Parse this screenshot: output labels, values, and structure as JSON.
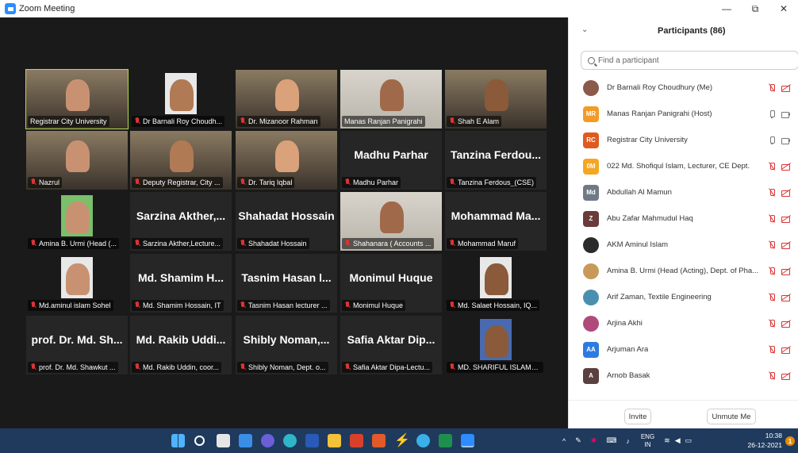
{
  "window": {
    "title": "Zoom Meeting",
    "minimize": "—",
    "restore": "⧉",
    "close": "✕"
  },
  "tiles": [
    {
      "big": "",
      "label": "Registrar City University",
      "muted": false,
      "video": true
    },
    {
      "big": "",
      "label": "Dr Barnali Roy Choudh...",
      "muted": true,
      "video": true
    },
    {
      "big": "",
      "label": "Dr. Mizanoor Rahman",
      "muted": true,
      "video": true
    },
    {
      "big": "",
      "label": "Manas Ranjan Panigrahi",
      "muted": false,
      "video": true
    },
    {
      "big": "",
      "label": "Shah E Alam",
      "muted": true,
      "video": true
    },
    {
      "big": "",
      "label": "Nazrul",
      "muted": true,
      "video": true
    },
    {
      "big": "",
      "label": "Deputy Registrar, City ...",
      "muted": true,
      "video": true
    },
    {
      "big": "",
      "label": "Dr. Tariq Iqbal",
      "muted": true,
      "video": true
    },
    {
      "big": "Madhu Parhar",
      "label": "Madhu Parhar",
      "muted": true,
      "video": false
    },
    {
      "big": "Tanzina Ferdou...",
      "label": "Tanzina Ferdous_(CSE)",
      "muted": true,
      "video": false
    },
    {
      "big": "",
      "label": "Amina B. Urmi (Head (...",
      "muted": true,
      "video": true
    },
    {
      "big": "Sarzina Akther,...",
      "label": "Sarzina Akther,Lecture...",
      "muted": true,
      "video": false
    },
    {
      "big": "Shahadat Hossain",
      "label": "Shahadat Hossain",
      "muted": true,
      "video": false
    },
    {
      "big": "",
      "label": "Shahanara ( Accounts ...",
      "muted": true,
      "video": true
    },
    {
      "big": "Mohammad Ma...",
      "label": "Mohammad Maruf",
      "muted": true,
      "video": false
    },
    {
      "big": "",
      "label": "Md.aminul islam Sohel",
      "muted": true,
      "video": true
    },
    {
      "big": "Md. Shamim H...",
      "label": "Md. Shamim Hossain, IT",
      "muted": true,
      "video": false
    },
    {
      "big": "Tasnim Hasan l...",
      "label": "Tasnim Hasan lecturer ...",
      "muted": true,
      "video": false
    },
    {
      "big": "Monimul Huque",
      "label": "Monimul Huque",
      "muted": true,
      "video": false
    },
    {
      "big": "",
      "label": "Md. Salaet Hossain, IQ...",
      "muted": true,
      "video": true
    },
    {
      "big": "prof. Dr. Md. Sh...",
      "label": "prof. Dr. Md. Shawkut ...",
      "muted": true,
      "video": false
    },
    {
      "big": "Md. Rakib Uddi...",
      "label": "Md. Rakib Uddin, coor...",
      "muted": true,
      "video": false
    },
    {
      "big": "Shibly Noman,...",
      "label": "Shibly Noman, Dept. o...",
      "muted": true,
      "video": false
    },
    {
      "big": "Safia Aktar Dip...",
      "label": "Safia Aktar Dipa-Lectu...",
      "muted": true,
      "video": false
    },
    {
      "big": "",
      "label": "MD. SHARIFUL ISLAM_...",
      "muted": true,
      "video": true
    }
  ],
  "panel": {
    "collapse": "⌄",
    "title": "Participants (86)",
    "search_placeholder": "Find a participant",
    "participants": [
      {
        "initials": "",
        "color": "#8a5a4a",
        "photo": true,
        "name": "Dr Barnali Roy Choudhury (Me)",
        "muted": true
      },
      {
        "initials": "MR",
        "color": "#f29b27",
        "photo": false,
        "name": "Manas Ranjan Panigrahi (Host)",
        "muted": false
      },
      {
        "initials": "RC",
        "color": "#e05a1f",
        "photo": false,
        "name": "Registrar City University",
        "muted": false
      },
      {
        "initials": "0M",
        "color": "#f5a623",
        "photo": false,
        "name": "022 Md. Shofiqul Islam, Lecturer, CE Dept.",
        "muted": true
      },
      {
        "initials": "Md",
        "color": "#6f7a86",
        "photo": false,
        "name": "Abdullah Al Mamun",
        "muted": true
      },
      {
        "initials": "Z",
        "color": "#6b3a3a",
        "photo": false,
        "name": "Abu Zafar Mahmudul Haq",
        "muted": true
      },
      {
        "initials": "",
        "color": "#2b2b2b",
        "photo": true,
        "name": "AKM Aminul Islam",
        "muted": true
      },
      {
        "initials": "",
        "color": "#c79a5a",
        "photo": true,
        "name": "Amina B. Urmi (Head (Acting), Dept. of Pha...",
        "muted": true
      },
      {
        "initials": "",
        "color": "#4a8fb0",
        "photo": true,
        "name": "Arif Zaman, Textile Engineering",
        "muted": true
      },
      {
        "initials": "",
        "color": "#b04a7a",
        "photo": true,
        "name": "Arjina Akhi",
        "muted": true
      },
      {
        "initials": "AA",
        "color": "#2d7be0",
        "photo": false,
        "name": "Arjuman Ara",
        "muted": true
      },
      {
        "initials": "A",
        "color": "#5b4040",
        "photo": false,
        "name": "Arnob Basak",
        "muted": true
      }
    ],
    "invite": "Invite",
    "unmute": "Unmute Me"
  },
  "taskbar": {
    "lang_top": "ENG",
    "lang_bottom": "IN",
    "time": "10:38",
    "date": "26-12-2021",
    "notifications": "1",
    "tray_up": "^"
  }
}
